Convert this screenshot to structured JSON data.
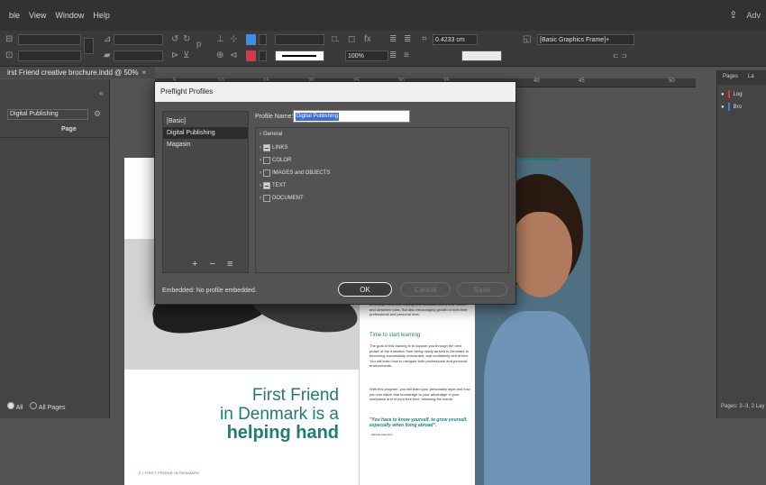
{
  "menubar": {
    "items": [
      "ble",
      "View",
      "Window",
      "Help"
    ],
    "right_label": "Adv"
  },
  "controlbar": {
    "field_stroke": "0.4233 cm",
    "field_percent": "100%",
    "frame_style": "[Basic Graphics Frame]+"
  },
  "document": {
    "tab_title": "irst Friend creative brochure.indd @ 50%",
    "tab_close": "×",
    "ruler_ticks": [
      "5",
      "10",
      "15",
      "20",
      "25",
      "30",
      "35",
      "40",
      "45",
      "50"
    ]
  },
  "left_panel": {
    "collapse": "«",
    "select_value": "Digital Publishing",
    "column_header": "Page",
    "radio_all": "All",
    "radio_all_pages": "All Pages"
  },
  "page_left": {
    "headline_line1": "First Friend",
    "headline_line2": "in Denmark is a",
    "headline_line3": "helping hand",
    "footer": "2 | FIRST FRIEND IN DENMARK"
  },
  "page_right": {
    "intro_text": "providing a shortcut, easing their transition into a new culture and unwritten rules. But also encouraging growth in both their professional and personal lives.",
    "heading": "Time to start learning",
    "body_text": "The goal of this training is to support you through the next phase of the transition from being newly arrived in Denmark to becoming successfully onboarded, and confidently self-driven. You will learn how to navigate both professional and personal environments.",
    "body_text2": "With this program, you will learn your personality style and how you can utilize that knowledge to your advantage in your workplace and in your free time, following the words:",
    "quote": "\"You have to know yourself, to grow yourself, especially when living abroad\".",
    "quote_attrib": "- Hannah Aajunsen"
  },
  "right_panel": {
    "tab_pages": "Pages",
    "tab_layers": "La",
    "items": [
      {
        "label": "Log",
        "color": "#e0323c"
      },
      {
        "label": "Bro",
        "color": "#3b7fd6"
      }
    ],
    "status": "Pages: 2–3, 2 Lay"
  },
  "dialog": {
    "title": "Preflight Profiles",
    "profiles": [
      "[Basic]",
      "Digital Publishing",
      "Magasin"
    ],
    "selected_profile": "Digital Publishing",
    "profile_name_label": "Profile Name:",
    "profile_name_value": "Digital Publishing",
    "tree": [
      {
        "label": "General",
        "checkbox": "none"
      },
      {
        "label": "LINKS",
        "checkbox": "mixed"
      },
      {
        "label": "COLOR",
        "checkbox": "empty"
      },
      {
        "label": "IMAGES and OBJECTS",
        "checkbox": "empty"
      },
      {
        "label": "TEXT",
        "checkbox": "mixed"
      },
      {
        "label": "DOCUMENT",
        "checkbox": "empty"
      }
    ],
    "footer_icons": "+ − ≡",
    "embedded_text": "Embedded: No profile embedded.",
    "ok": "OK",
    "cancel": "Cancel",
    "save": "Save"
  }
}
